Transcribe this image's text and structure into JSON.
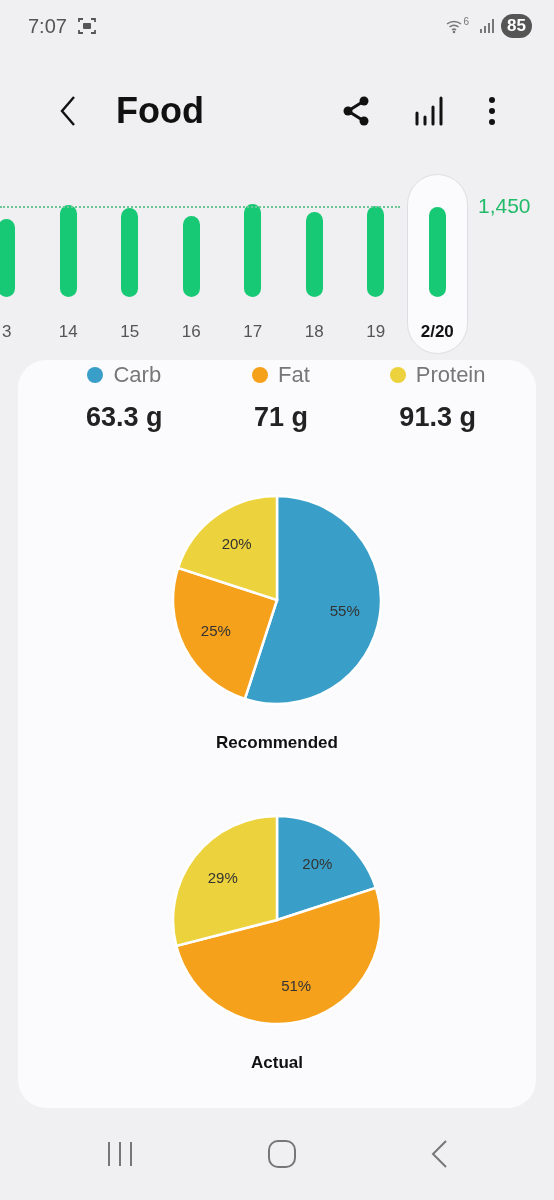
{
  "status_bar": {
    "time": "7:07",
    "wifi_label": "6",
    "battery": "85"
  },
  "header": {
    "title": "Food"
  },
  "daily_chart": {
    "goal": "1,450",
    "days": [
      {
        "label": "3",
        "selected": false
      },
      {
        "label": "14",
        "selected": false
      },
      {
        "label": "15",
        "selected": false
      },
      {
        "label": "16",
        "selected": false
      },
      {
        "label": "17",
        "selected": false
      },
      {
        "label": "18",
        "selected": false
      },
      {
        "label": "19",
        "selected": false
      },
      {
        "label": "2/20",
        "selected": true
      }
    ]
  },
  "nutrients": [
    {
      "name": "Carb",
      "amount": "63.3 g",
      "color": "#3a9fc8"
    },
    {
      "name": "Fat",
      "amount": "71 g",
      "color": "#f5a11c"
    },
    {
      "name": "Protein",
      "amount": "91.3 g",
      "color": "#ecd23c"
    }
  ],
  "pies": [
    {
      "caption": "Recommended",
      "chart_data": {
        "type": "pie",
        "values": [
          55,
          25,
          20
        ],
        "value_labels": [
          "55%",
          "25%",
          "20%"
        ]
      }
    },
    {
      "caption": "Actual",
      "chart_data": {
        "type": "pie",
        "values": [
          20,
          51,
          29
        ],
        "value_labels": [
          "20%",
          "51%",
          "29%"
        ]
      }
    }
  ]
}
